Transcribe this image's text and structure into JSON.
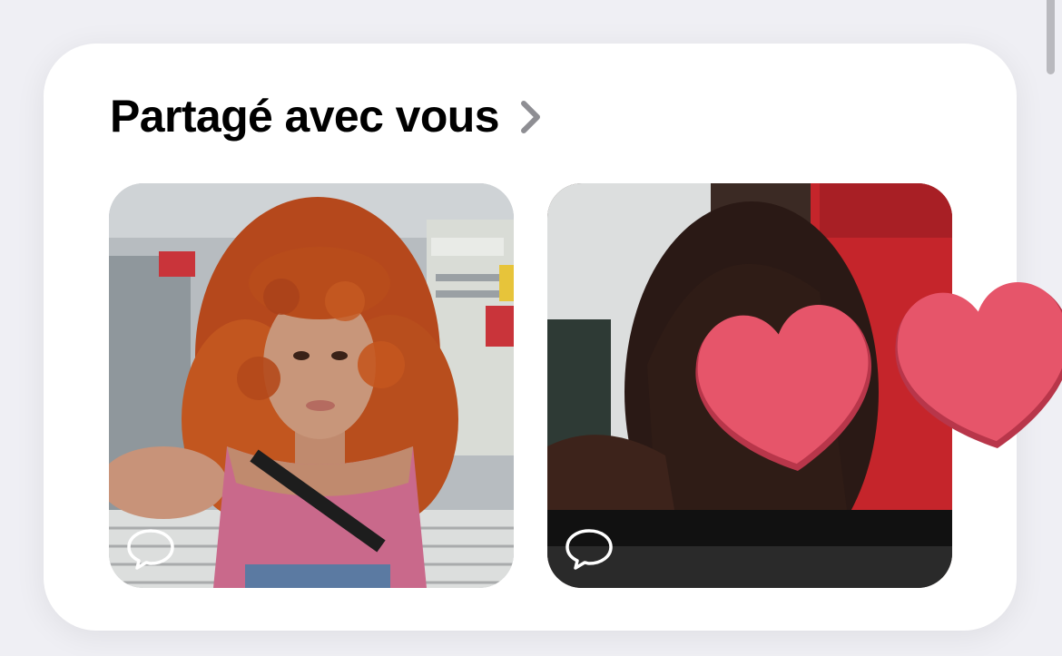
{
  "section": {
    "title": "Partagé avec vous",
    "chevron_icon": "chevron-right-icon"
  },
  "photos": [
    {
      "label": "shared-photo-1",
      "comment_icon": "speech-bubble-icon"
    },
    {
      "label": "shared-photo-2",
      "comment_icon": "speech-bubble-icon"
    }
  ],
  "stickers": [
    "heart-sticker",
    "heart-sticker"
  ],
  "colors": {
    "background": "#efeff4",
    "card": "#ffffff",
    "chevron": "#8e8e93",
    "heart": "#e6556a"
  }
}
